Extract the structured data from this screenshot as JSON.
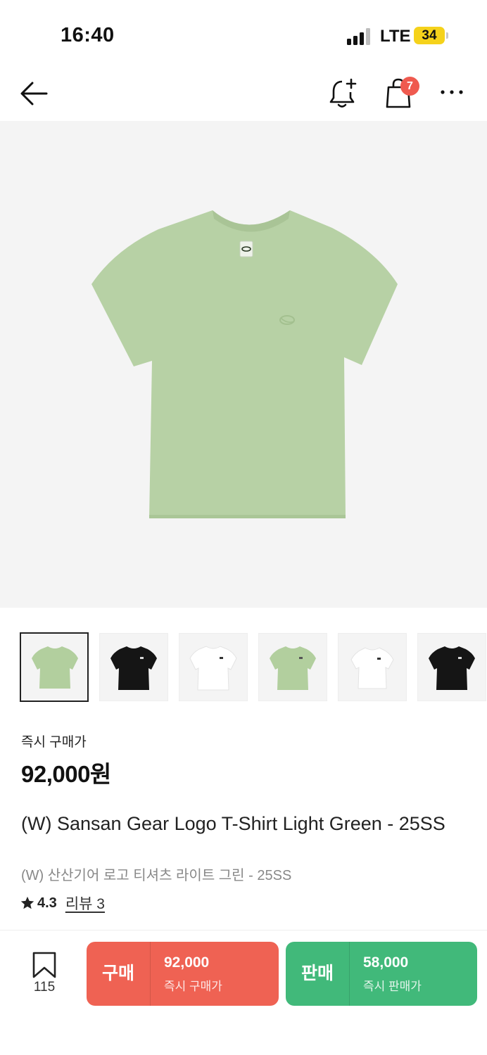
{
  "status_bar": {
    "time": "16:40",
    "network": "LTE",
    "battery": "34"
  },
  "nav": {
    "back_icon": "arrow-left-icon",
    "alert_icon": "bell-plus-icon",
    "cart_icon": "shopping-bag-icon",
    "cart_count": "7",
    "more_icon": "more-horizontal-icon"
  },
  "product_image": {
    "shirt_color": "#b7d1a5",
    "background": "#f4f4f4"
  },
  "thumbnails": [
    {
      "color": "green",
      "fill": "#b2cf9e",
      "selected": true
    },
    {
      "color": "black",
      "fill": "#151515",
      "selected": false
    },
    {
      "color": "white",
      "fill": "#ffffff",
      "selected": false
    },
    {
      "color": "green",
      "fill": "#b2cf9e",
      "selected": false
    },
    {
      "color": "white",
      "fill": "#ffffff",
      "selected": false
    },
    {
      "color": "black",
      "fill": "#151515",
      "selected": false
    }
  ],
  "price": {
    "label": "즉시 구매가",
    "value": "92,000원"
  },
  "product": {
    "title_en": "(W) Sansan Gear Logo T-Shirt Light Green - 25SS",
    "title_ko": "(W) 산산기어 로고 티셔츠 라이트 그린 - 25SS",
    "rating": "4.3",
    "review_link": "리뷰 3"
  },
  "bottom_bar": {
    "bookmark_count": "115",
    "buy": {
      "label": "구매",
      "price": "92,000",
      "sub": "즉시 구매가",
      "color": "#ef6253"
    },
    "sell": {
      "label": "판매",
      "price": "58,000",
      "sub": "즉시 판매가",
      "color": "#41b97a"
    }
  }
}
